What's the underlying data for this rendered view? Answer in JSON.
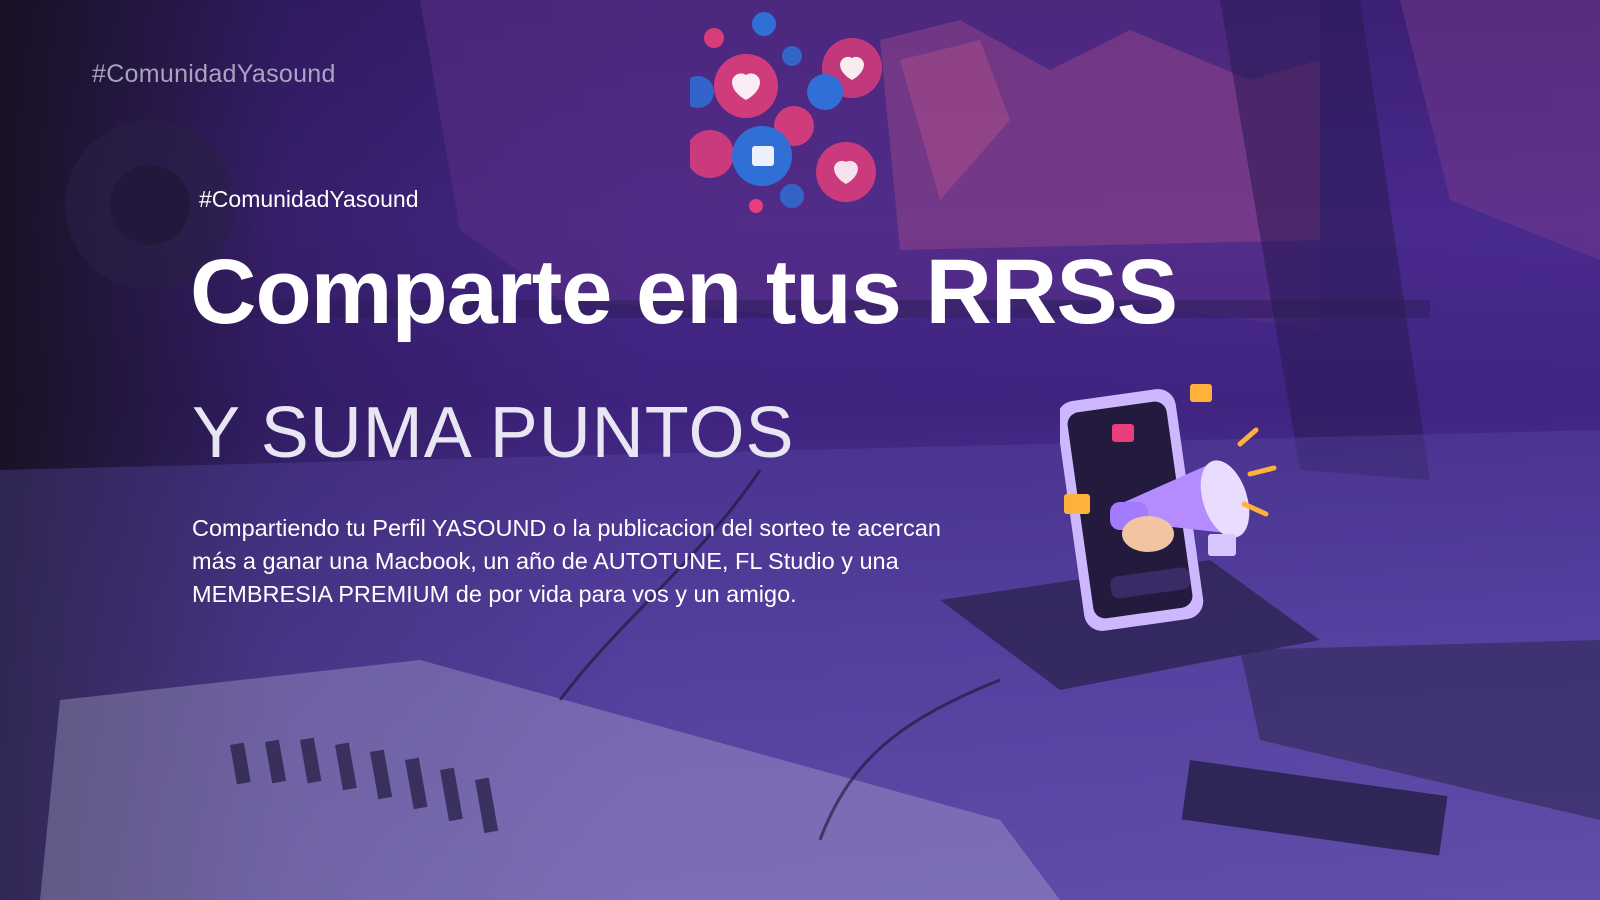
{
  "slide": {
    "hashtag_top": "#ComunidadYasound",
    "hashtag_main": "#ComunidadYasound",
    "title": "Comparte en tus RRSS",
    "subtitle": "Y SUMA PUNTOS",
    "body": "Compartiendo tu Perfil YASOUND o la publicacion del sorteo te acercan más a ganar una Macbook, un año de AUTOTUNE, FL Studio y una MEMBRESIA PREMIUM de por vida para vos y un amigo."
  },
  "icons": {
    "reactions": "heart-and-like-reactions-icon",
    "phone_megaphone": "phone-megaphone-illustration"
  },
  "colors": {
    "accent_purple": "#6a3fc8",
    "heart_pink": "#e83e7a",
    "like_blue": "#2f6fd6",
    "text_white": "#ffffff"
  }
}
